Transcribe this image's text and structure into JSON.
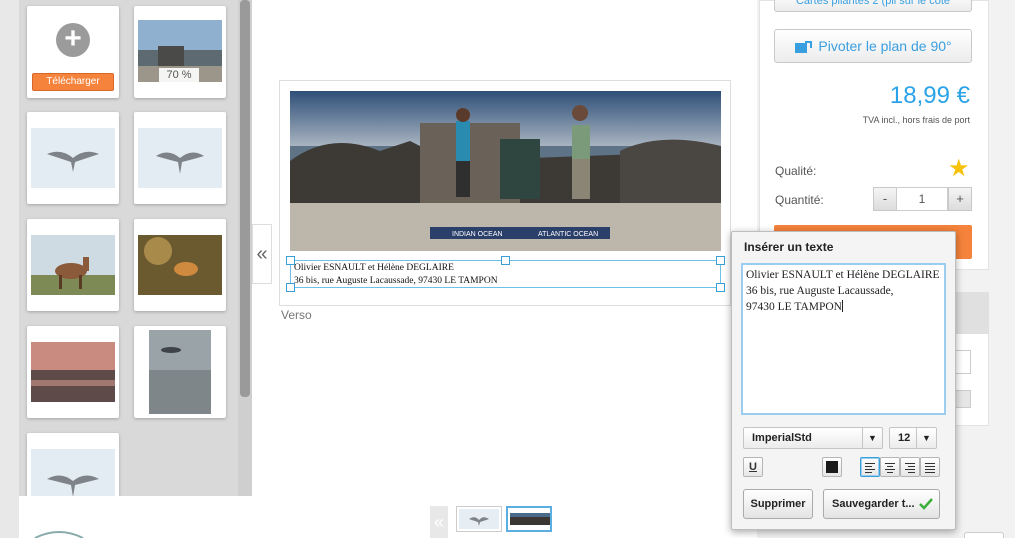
{
  "upload": {
    "label": "Télécharger"
  },
  "photos": {
    "zoom_badge": "70 %"
  },
  "canvas": {
    "photo_labels": {
      "left": "INDIAN OCEAN",
      "right": "ATLANTIC OCEAN"
    },
    "text_lines": [
      "Olivier ESNAULT et Hélène DEGLAIRE",
      "36 bis, rue Auguste Lacaussade, 97430 LE TAMPON"
    ],
    "side_label": "Verso",
    "collapse_glyph": "«",
    "pager_prev_glyph": "«"
  },
  "product": {
    "top_button_partial": "Cartes pliantes 2 (pli sur le côté",
    "rotate_label": "Pivoter le plan de 90°",
    "price": "18,99 €",
    "tax_note": "TVA incl., hors frais de port",
    "quality_label": "Qualité:",
    "quantity_label": "Quantité:",
    "quantity_value": "1",
    "minus": "-",
    "plus": "+"
  },
  "popup": {
    "title": "Insérer un texte",
    "text_lines": [
      "Olivier ESNAULT et Hélène DEGLAIRE",
      "36 bis, rue Auguste Lacaussade,",
      "97430 LE TAMPON"
    ],
    "font_family": "ImperialStd",
    "font_size": "12",
    "underline": "U",
    "delete_label": "Supprimer",
    "save_label": "Sauvegarder t...",
    "text_color": "#1a1a1a"
  },
  "colors": {
    "accent": "#2aa3e8",
    "orange": "#f5833b",
    "confirm": "#3cae3c"
  }
}
